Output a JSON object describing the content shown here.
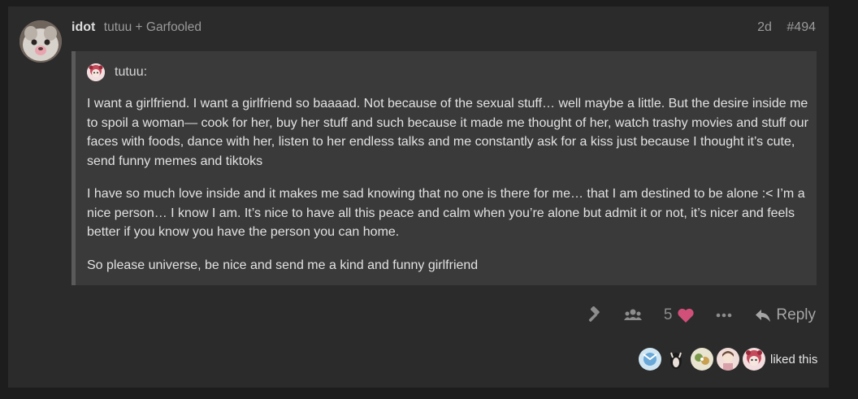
{
  "post": {
    "username": "idot",
    "reply_to": "tutuu + Garfooled",
    "age": "2d",
    "post_number": "#494"
  },
  "quote": {
    "author": "tutuu:",
    "paragraphs": [
      "I want a girlfriend. I want a girlfriend so baaaad. Not because of the sexual stuff… well maybe a little. But the desire inside me to spoil a woman— cook for her, buy her stuff and such because it made me thought of her, watch trashy movies and stuff our faces with foods, dance with her, listen to her endless talks and me constantly ask for a kiss just because I thought it’s cute, send funny memes and tiktoks",
      "I have so much love inside and it makes me sad knowing that no one is there for me… that I am destined to be alone :< I’m a nice person… I know I am. It’s nice to have all this peace and calm when you’re alone but admit it or not, it’s nicer and feels better if you know you have the person you can home.",
      "So please universe, be nice and send me a kind and funny girlfriend"
    ]
  },
  "actions": {
    "like_count": "5",
    "reply_label": "Reply",
    "icons": [
      "hammer-icon",
      "users-icon",
      "heart-icon",
      "more-icon",
      "reply-icon"
    ]
  },
  "likers": {
    "label": "liked this",
    "count": 5
  },
  "colors": {
    "background": "#1d1d1d",
    "post_bg": "#2b2b2b",
    "quote_bg": "#3a3a3a",
    "quote_border": "#5a5a5a",
    "heart": "#d0507a",
    "muted": "#8d8d8d"
  }
}
